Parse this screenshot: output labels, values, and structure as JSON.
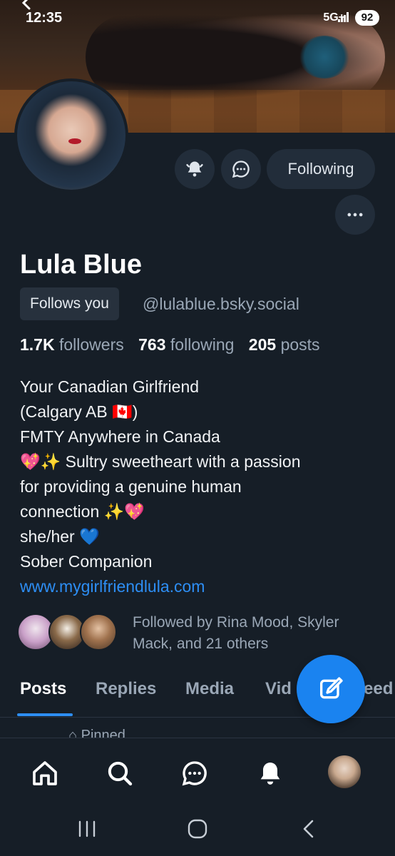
{
  "status_bar": {
    "time": "12:35",
    "network": "5G+",
    "battery": "92"
  },
  "profile": {
    "name": "Lula Blue",
    "follows_you_label": "Follows you",
    "handle": "@lulablue.bsky.social",
    "follow_button_label": "Following"
  },
  "stats": {
    "followers_count": "1.7K",
    "followers_label": "followers",
    "following_count": "763",
    "following_label": "following",
    "posts_count": "205",
    "posts_label": "posts"
  },
  "bio": {
    "lines": [
      "Your Canadian Girlfriend",
      "(Calgary AB 🇨🇦)",
      "FMTY Anywhere in Canada",
      "💖✨ Sultry sweetheart with a passion",
      "for providing a genuine human",
      "connection ✨💖",
      "she/her 💙",
      "Sober Companion"
    ],
    "link": "www.mygirlfriendlula.com"
  },
  "followed_by": "Followed by Rina Mood, Skyler Mack, and 21 others",
  "tabs": [
    "Posts",
    "Replies",
    "Media",
    "Vid",
    "eed"
  ],
  "pinned_label": "Pinned",
  "icons": {
    "back": "chevron-left-icon",
    "notify": "bell-icon",
    "message": "chat-bubble-icon",
    "more": "more-horizontal-icon",
    "compose": "compose-icon",
    "nav": [
      "home-icon",
      "search-icon",
      "chat-icon",
      "bell-icon",
      "avatar"
    ]
  },
  "colors": {
    "accent": "#2d8ef4",
    "fab": "#1a83f0",
    "background": "#161e27"
  }
}
